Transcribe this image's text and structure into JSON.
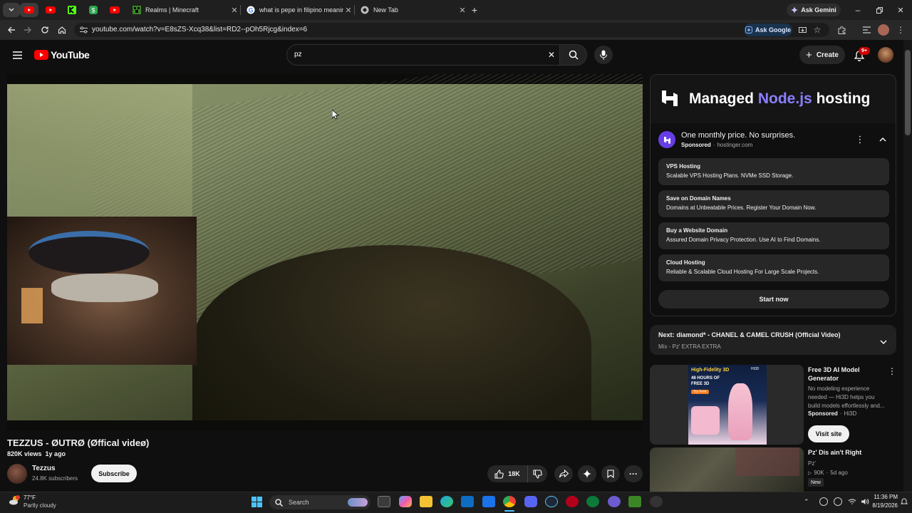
{
  "browser": {
    "tabs": [
      {
        "title": "Realms | Minecraft",
        "icon": "minecraft-icon"
      },
      {
        "title": "what is pepe in filipino meaning",
        "icon": "google-icon"
      },
      {
        "title": "New Tab",
        "icon": "chrome-icon"
      }
    ],
    "ask_gemini": "Ask Gemini",
    "url": "youtube.com/watch?v=E8sZS-Xcq38&list=RD2--pOh5Rjcg&index=6",
    "ask_google": "Ask Google"
  },
  "youtube": {
    "logo_text": "YouTube",
    "search_value": "pz",
    "create_label": "Create",
    "notif_badge": "9+"
  },
  "video": {
    "title": "TEZZUS - ØUTRØ (Øffical videø)",
    "views": "820K views",
    "age": "1y ago",
    "channel": "Tezzus",
    "subscribers": "24.8K subscribers",
    "subscribe_label": "Subscribe",
    "likes": "18K"
  },
  "ad": {
    "banner_prefix": "Managed",
    "banner_accent": "Node.js",
    "banner_suffix": "hosting",
    "headline": "One monthly price. No surprises.",
    "sponsored": "Sponsored",
    "domain": "hostinger.com",
    "links": [
      {
        "title": "VPS Hosting",
        "desc": "Scalable VPS Hosting Plans. NVMe SSD Storage."
      },
      {
        "title": "Save on Domain Names",
        "desc": "Domains at Unbeatable Prices. Register Your Domain Now."
      },
      {
        "title": "Buy a Website Domain",
        "desc": "Assured Domain Privacy Protection. Use AI to Find Domains."
      },
      {
        "title": "Cloud Hosting",
        "desc": "Reliable & Scalable Cloud Hosting For Large Scale Projects."
      }
    ],
    "cta": "Start now",
    "accent_color": "#7b6cf6"
  },
  "playlist": {
    "next_prefix": "Next:",
    "next_title": "diamond* - CHANEL & CAMEL CRUSH (Official Video)",
    "sub": "Mix - Pz' EXTRA EXTRA"
  },
  "ad2": {
    "title": "Free 3D AI Model Generator",
    "desc": "No modeling experience needed — Hi3D helps you build models effortlessly and...",
    "sponsored": "Sponsored",
    "brand": "Hi3D",
    "cta": "Visit site",
    "thumb_line1": "High-Fidelity 3D",
    "thumb_line2": "48 HOURS OF",
    "thumb_line3": "FREE 3D",
    "thumb_btn": "Try Free",
    "thumb_brand": "HI3D"
  },
  "rec": {
    "title": "Pz' Dis ain't Right",
    "channel": "Pz'",
    "views": "90K",
    "age": "5d ago",
    "badge": "New"
  },
  "taskbar": {
    "temp": "77°F",
    "weather": "Partly cloudy",
    "search": "Search",
    "time": "11:36 PM",
    "date": "8/19/2026"
  }
}
